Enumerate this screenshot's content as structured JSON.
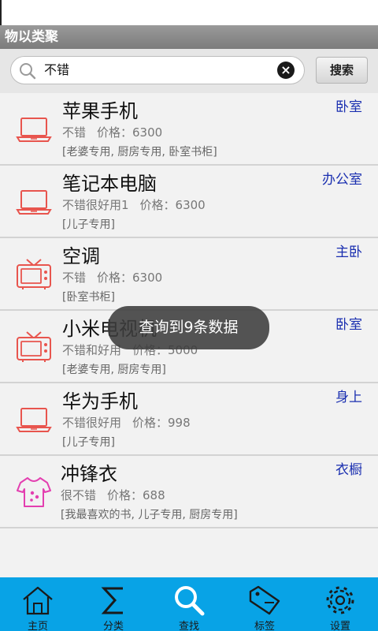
{
  "app": {
    "title": "物以类聚"
  },
  "search": {
    "query": "不错",
    "button_label": "搜索",
    "clear_icon": "clear-icon"
  },
  "items": [
    {
      "name": "苹果手机",
      "location": "卧室",
      "desc": "不错",
      "price_label": "价格：6300",
      "tags": "[老婆专用, 厨房专用, 卧室书柜]",
      "icon": "laptop-icon"
    },
    {
      "name": "笔记本电脑",
      "location": "办公室",
      "desc": "不错很好用1",
      "price_label": "价格：6300",
      "tags": "[儿子专用]",
      "icon": "laptop-icon"
    },
    {
      "name": "空调",
      "location": "主卧",
      "desc": "不错",
      "price_label": "价格：6300",
      "tags": "[卧室书柜]",
      "icon": "tv-icon"
    },
    {
      "name": "小米电视机",
      "location": "卧室",
      "desc": "不错和好用",
      "price_label": "价格：5000",
      "tags": "[老婆专用, 厨房专用]",
      "icon": "tv-icon"
    },
    {
      "name": "华为手机",
      "location": "身上",
      "desc": "不错很好用",
      "price_label": "价格：998",
      "tags": "[儿子专用]",
      "icon": "laptop-icon"
    },
    {
      "name": "冲锋衣",
      "location": "衣橱",
      "desc": "很不错",
      "price_label": "价格：688",
      "tags": "[我最喜欢的书, 儿子专用, 厨房专用]",
      "icon": "clothes-icon"
    }
  ],
  "toast": {
    "text": "查询到9条数据"
  },
  "tabs": [
    {
      "label": "主页",
      "icon": "home-icon"
    },
    {
      "label": "分类",
      "icon": "sigma-icon"
    },
    {
      "label": "查找",
      "icon": "search-icon"
    },
    {
      "label": "标签",
      "icon": "tag-icon"
    },
    {
      "label": "设置",
      "icon": "gear-icon"
    }
  ],
  "colors": {
    "accent": "#08a3e6",
    "location": "#1a2fb0",
    "icon_red": "#e8554e",
    "icon_pink": "#e33fb0"
  }
}
